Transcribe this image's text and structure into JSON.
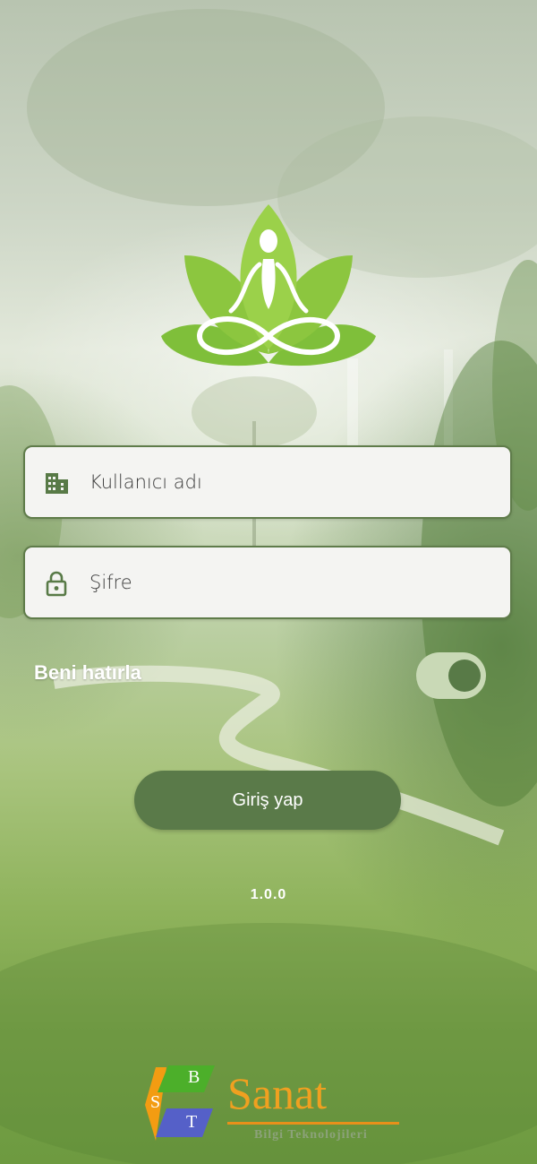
{
  "login_form": {
    "username_placeholder": "Kullanıcı adı",
    "password_placeholder": "Şifre",
    "remember_label": "Beni hatırla",
    "remember_enabled": true,
    "login_button_label": "Giriş yap"
  },
  "version": "1.0.0",
  "brand": {
    "name": "Sanat",
    "subtitle": "Bilgi Teknolojileri",
    "letters": [
      "S",
      "B",
      "T"
    ]
  },
  "icons": {
    "logo": "lotus-meditation-logo",
    "username": "building-icon",
    "password": "lock-icon"
  },
  "colors": {
    "accent": "#5a7a49",
    "toggle_track": "#c9d9b6",
    "brand_orange": "#f0a020",
    "field_bg": "#f4f4f2"
  }
}
